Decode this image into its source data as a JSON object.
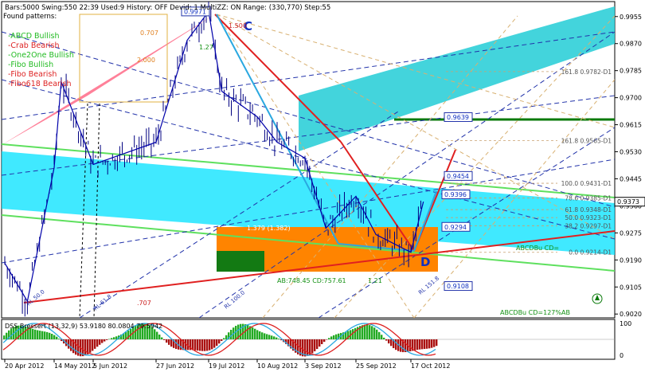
{
  "info_line": {
    "text": "Bars:5000  Swing:550  22:39  Used:9  History: OFF  Devid: 1  MultiZZ: ON  Range: (330,770)  Step:55"
  },
  "found_patterns": {
    "title": "Found patterns:",
    "items": [
      {
        "label": "-ABCD Bullish",
        "color": "#22bb22"
      },
      {
        "label": "-Crab Bearish",
        "color": "#dd2222"
      },
      {
        "label": "-One2One Bullish",
        "color": "#22bb22"
      },
      {
        "label": "-Fibo Bullish",
        "color": "#22bb22"
      },
      {
        "label": "-Fibo Bearish",
        "color": "#dd2222"
      },
      {
        "label": "-Fibo618 Bearish",
        "color": "#dd2222"
      }
    ]
  },
  "chart_data": [
    {
      "type": "line",
      "chart_kind": "ohlc-bars",
      "y_ticks": [
        0.9955,
        0.987,
        0.9785,
        0.97,
        0.9615,
        0.953,
        0.9445,
        0.936,
        0.9275,
        0.919,
        0.9105,
        0.902
      ],
      "x_ticks": [
        "20 Apr 2012",
        "14 May 2012",
        "5 Jun 2012",
        "27 Jun 2012",
        "19 Jul 2012",
        "10 Aug 2012",
        "3 Sep 2012",
        "25 Sep 2012",
        "17 Oct 2012"
      ],
      "ylim": [
        0.9008,
        1.0002
      ],
      "current_price": "0.9373",
      "series": [
        {
          "x": [
            "20 Apr 2012",
            "1 May 2012",
            "14 May 2012",
            "18 May 2012",
            "5 Jun 2012",
            "27 Jun 2012",
            "10 Jul 2012",
            "19 Jul 2012",
            "25 Jul 2012",
            "10 Aug 2012",
            "20 Aug 2012",
            "3 Sep 2012",
            "12 Sep 2012",
            "25 Sep 2012",
            "3 Oct 2012",
            "17 Oct 2012",
            "22 Oct 2012"
          ],
          "values": [
            0.918,
            0.906,
            0.948,
            0.975,
            0.949,
            0.956,
            0.988,
            0.9971,
            0.972,
            0.964,
            0.956,
            0.951,
            0.929,
            0.939,
            0.927,
            0.9214,
            0.9373
          ]
        }
      ],
      "price_boxes": [
        "0.9971",
        "0.9639",
        "0.9454",
        "0.9396",
        "0.9294",
        "0.9108"
      ],
      "fib_levels": [
        "161.8 0.9782-D1",
        "161.8 0.9565-D1",
        "100.0 0.9431-D1",
        "78.6 0.9385-D1",
        "61.8 0.9348-D1",
        "50.0 0.9323-D1",
        "38.2 0.9297-D1",
        "0.0 0.9214-D1"
      ],
      "annotations": [
        "C",
        "D",
        "1.379 (1.382)",
        "AB:748.45 CD:757.61",
        "1.21",
        "ABCDBu CD=127%AB",
        "ABCDBu CD=",
        "RL 151.8",
        "RL 100.0",
        "RL 61.8",
        "RL 50.0",
        "1.500",
        "1.27",
        "0.707",
        "2.000",
        ".707"
      ]
    },
    {
      "type": "bar",
      "title": "DSS Bressert (13,32,9) 53.9180 80.0804 79.5942",
      "y_ticks": [
        100,
        0
      ],
      "ylim": [
        0,
        100
      ],
      "x": [
        "20 Apr 2012",
        "14 May 2012",
        "5 Jun 2012",
        "27 Jun 2012",
        "19 Jul 2012",
        "10 Aug 2012",
        "3 Sep 2012",
        "25 Sep 2012",
        "17 Oct 2012"
      ]
    }
  ]
}
